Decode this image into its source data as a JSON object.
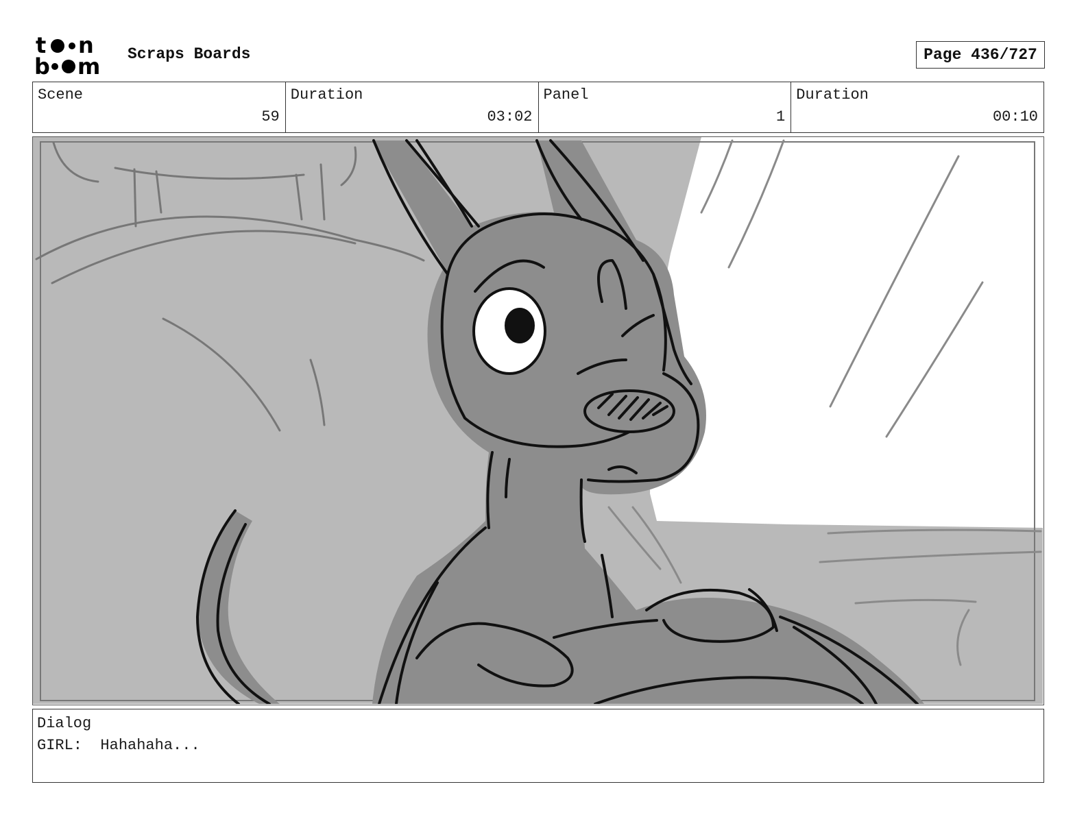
{
  "header": {
    "logo_top": "to●n",
    "logo_bottom": "b●●m",
    "title": "Scraps Boards",
    "page": "Page 436/727"
  },
  "info": {
    "scene_label": "Scene",
    "scene_value": "59",
    "scene_duration_label": "Duration",
    "scene_duration_value": "03:02",
    "panel_label": "Panel",
    "panel_value": "1",
    "panel_duration_label": "Duration",
    "panel_duration_value": "00:10"
  },
  "panel": {
    "image": "storyboard-sketch-kangaroo-character"
  },
  "dialog": {
    "label": "Dialog",
    "speaker": "GIRL:",
    "text": "Hahahaha..."
  }
}
